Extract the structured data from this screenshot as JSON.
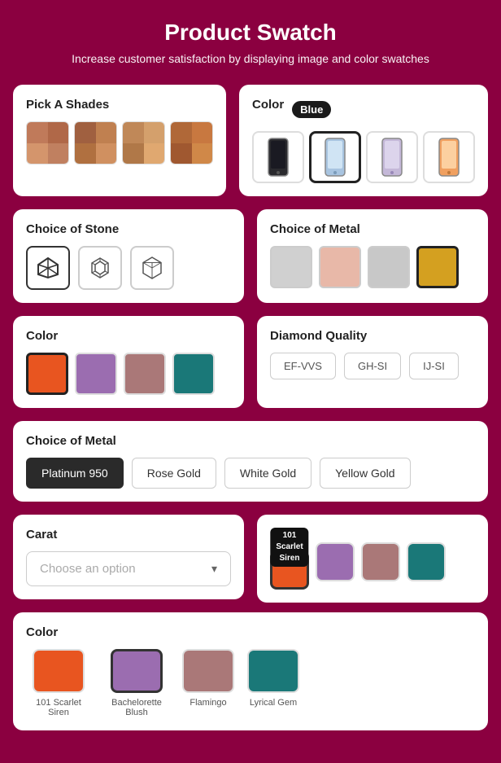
{
  "page": {
    "title": "Product Swatch",
    "subtitle": "Increase customer satisfaction by displaying image and color swatches"
  },
  "shades": {
    "title": "Pick A Shades",
    "swatches": [
      {
        "colors": [
          "#c07a5a",
          "#b06848",
          "#d4956c",
          "#c08060"
        ]
      },
      {
        "colors": [
          "#a06040",
          "#c08050",
          "#b07040",
          "#d09060"
        ]
      },
      {
        "colors": [
          "#c08858",
          "#d4a06c",
          "#b07848",
          "#e0a870"
        ]
      },
      {
        "colors": [
          "#b06838",
          "#c87840",
          "#a05830",
          "#d08848"
        ]
      }
    ]
  },
  "color_phone": {
    "title": "Color",
    "badge": "Blue",
    "phones": [
      {
        "color": "#2a2a2e",
        "active": false
      },
      {
        "color": "#a8c4e0",
        "active": true
      },
      {
        "color": "#c4b8d8",
        "active": false
      },
      {
        "color": "#f0a060",
        "active": false
      }
    ]
  },
  "choice_of_stone": {
    "title": "Choice of Stone",
    "stones": [
      "◇",
      "◈",
      "⬡"
    ],
    "active_index": 0
  },
  "choice_of_metal_color": {
    "title": "Choice of Metal",
    "swatches": [
      {
        "bg": "#d0d0d0",
        "active": false
      },
      {
        "bg": "#e8b8a8",
        "active": false
      },
      {
        "bg": "#c8c8c8",
        "active": false
      },
      {
        "bg": "#d4a020",
        "active": true
      }
    ]
  },
  "color_section": {
    "title": "Color",
    "swatches": [
      {
        "bg": "#e85520",
        "active": true
      },
      {
        "bg": "#9b6db0",
        "active": false
      },
      {
        "bg": "#aa7878",
        "active": false
      },
      {
        "bg": "#1a7878",
        "active": false
      }
    ]
  },
  "diamond_quality": {
    "title": "Diamond Quality",
    "options": [
      "EF-VVS",
      "GH-SI",
      "IJ-SI"
    ]
  },
  "choice_of_metal_text": {
    "title": "Choice of Metal",
    "options": [
      "Platinum 950",
      "Rose Gold",
      "White Gold",
      "Yellow Gold"
    ],
    "active_index": 0
  },
  "carat": {
    "title": "Carat",
    "placeholder": "Choose an option",
    "chevron": "▾"
  },
  "tooltip_swatches": {
    "tooltip": {
      "line1": "101",
      "line2": "Scarlet",
      "line3": "Siren"
    },
    "swatches": [
      {
        "bg": "#e85520",
        "active": true,
        "show_tooltip": true
      },
      {
        "bg": "#9b6db0",
        "active": false
      },
      {
        "bg": "#aa7878",
        "active": false
      },
      {
        "bg": "#1a7878",
        "active": false
      }
    ]
  },
  "bottom_color": {
    "title": "Color",
    "options": [
      {
        "label": "101 Scarlet Siren",
        "bg": "#e85520",
        "active": false
      },
      {
        "label": "Bachelorette Blush",
        "bg": "#9b6db0",
        "active": true
      },
      {
        "label": "Flamingo",
        "bg": "#aa7878",
        "active": false
      },
      {
        "label": "Lyrical Gem",
        "bg": "#1a7878",
        "active": false
      }
    ]
  }
}
